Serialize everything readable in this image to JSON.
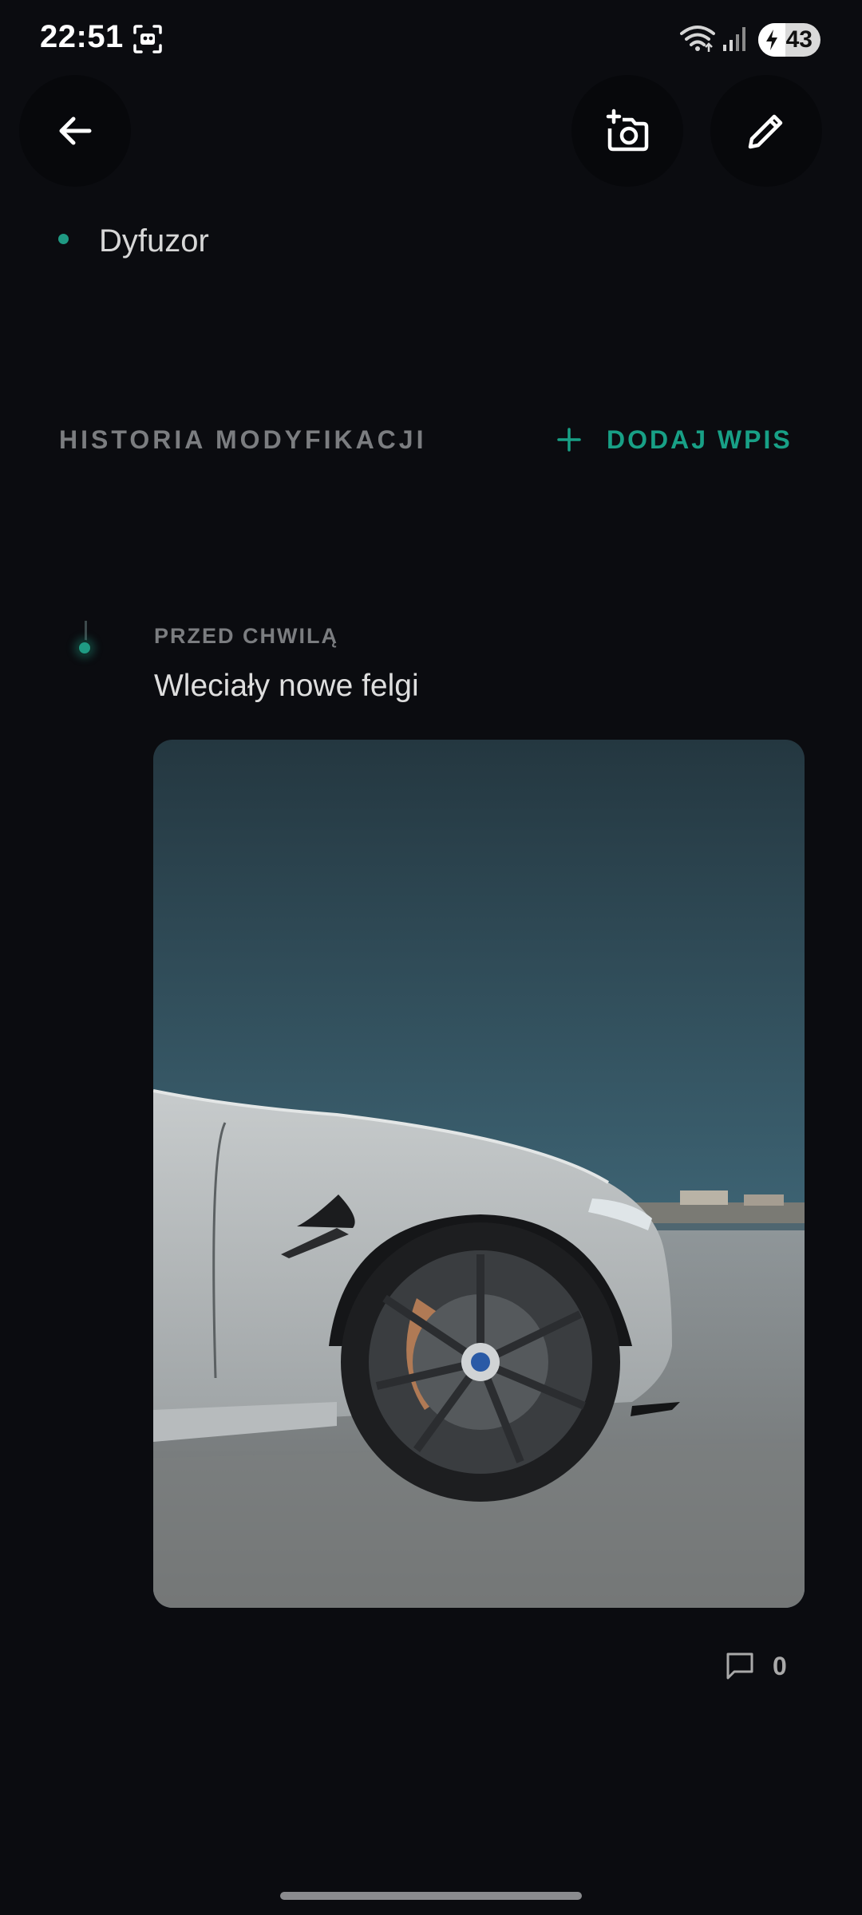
{
  "status_bar": {
    "time": "22:51",
    "battery": "43",
    "icons": [
      "screen-record-icon",
      "wifi-icon",
      "signal-icon",
      "battery-charging-icon"
    ]
  },
  "toolbar": {
    "icons": [
      "arrow-back-icon",
      "add-photo-icon",
      "edit-pencil-icon"
    ]
  },
  "mods_list": {
    "items": [
      {
        "label": "Dyfuzor"
      }
    ]
  },
  "history": {
    "section_title": "HISTORIA MODYFIKACJI",
    "add_entry_label": "DODAJ WPIS",
    "entries": [
      {
        "time": "PRZED CHWILĄ",
        "title": "Wleciały nowe felgi",
        "comments_count": "0"
      }
    ]
  },
  "colors": {
    "accent": "#1f9a83",
    "background": "#0b0c10",
    "muted_text": "#7b7d80"
  }
}
